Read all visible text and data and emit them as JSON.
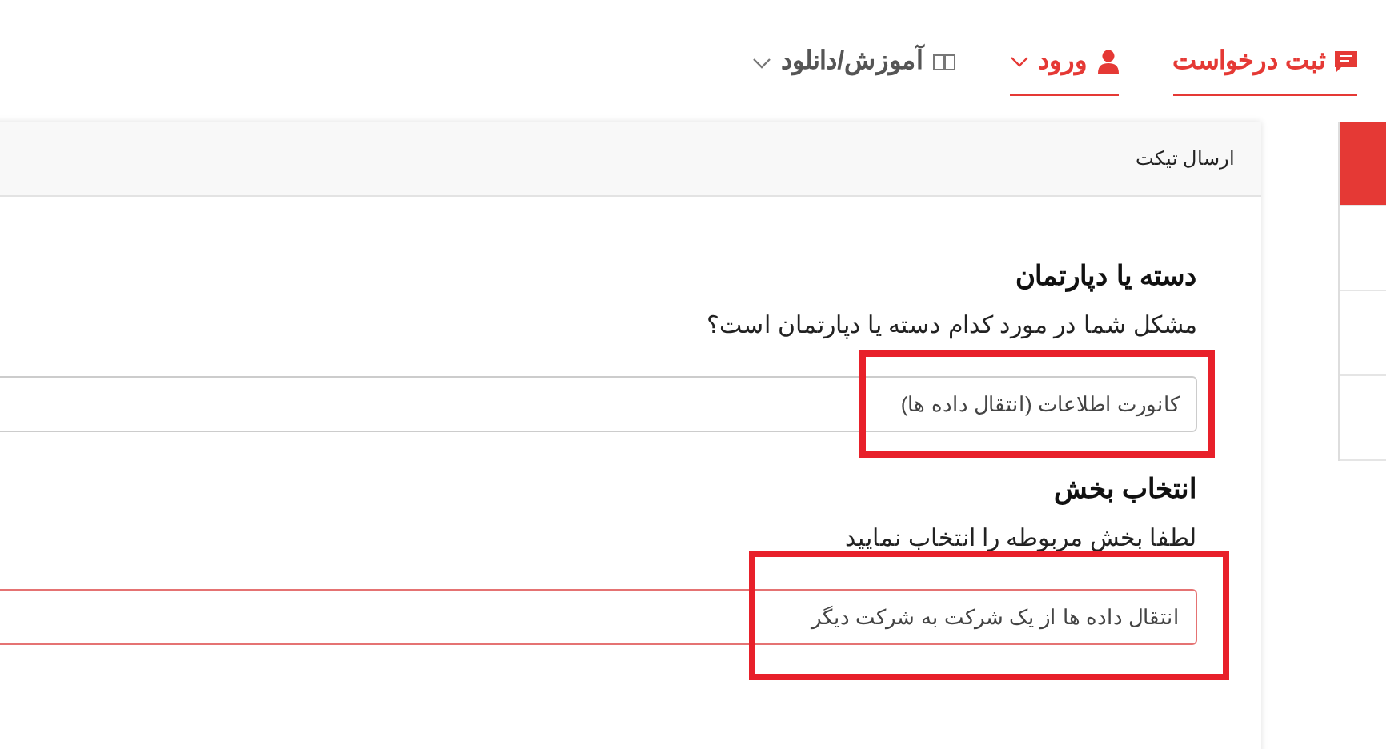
{
  "nav": [
    {
      "label": "ثبت درخواست",
      "kind": "chat",
      "active": true,
      "dropdown": false
    },
    {
      "label": "ورود",
      "kind": "user",
      "active": true,
      "dropdown": true
    },
    {
      "label": "آموزش/دانلود",
      "kind": "book",
      "active": false,
      "dropdown": true
    }
  ],
  "sidebar": {
    "items": [
      {
        "selected": true
      },
      {
        "selected": false
      },
      {
        "selected": false
      },
      {
        "selected": false
      }
    ]
  },
  "card": {
    "title": "ارسال تیکت",
    "sections": [
      {
        "heading": "دسته یا دپارتمان",
        "question": "مشکل شما در مورد کدام دسته یا دپارتمان است؟",
        "value": "کانورت اطلاعات (انتقال داده ها)",
        "focused": false,
        "highlighted": true
      },
      {
        "heading": "انتخاب بخش",
        "question": "لطفا بخش مربوطه را انتخاب نمایید",
        "value": "انتقال داده ها از یک شرکت به شرکت دیگر",
        "focused": true,
        "highlighted": true
      }
    ]
  }
}
